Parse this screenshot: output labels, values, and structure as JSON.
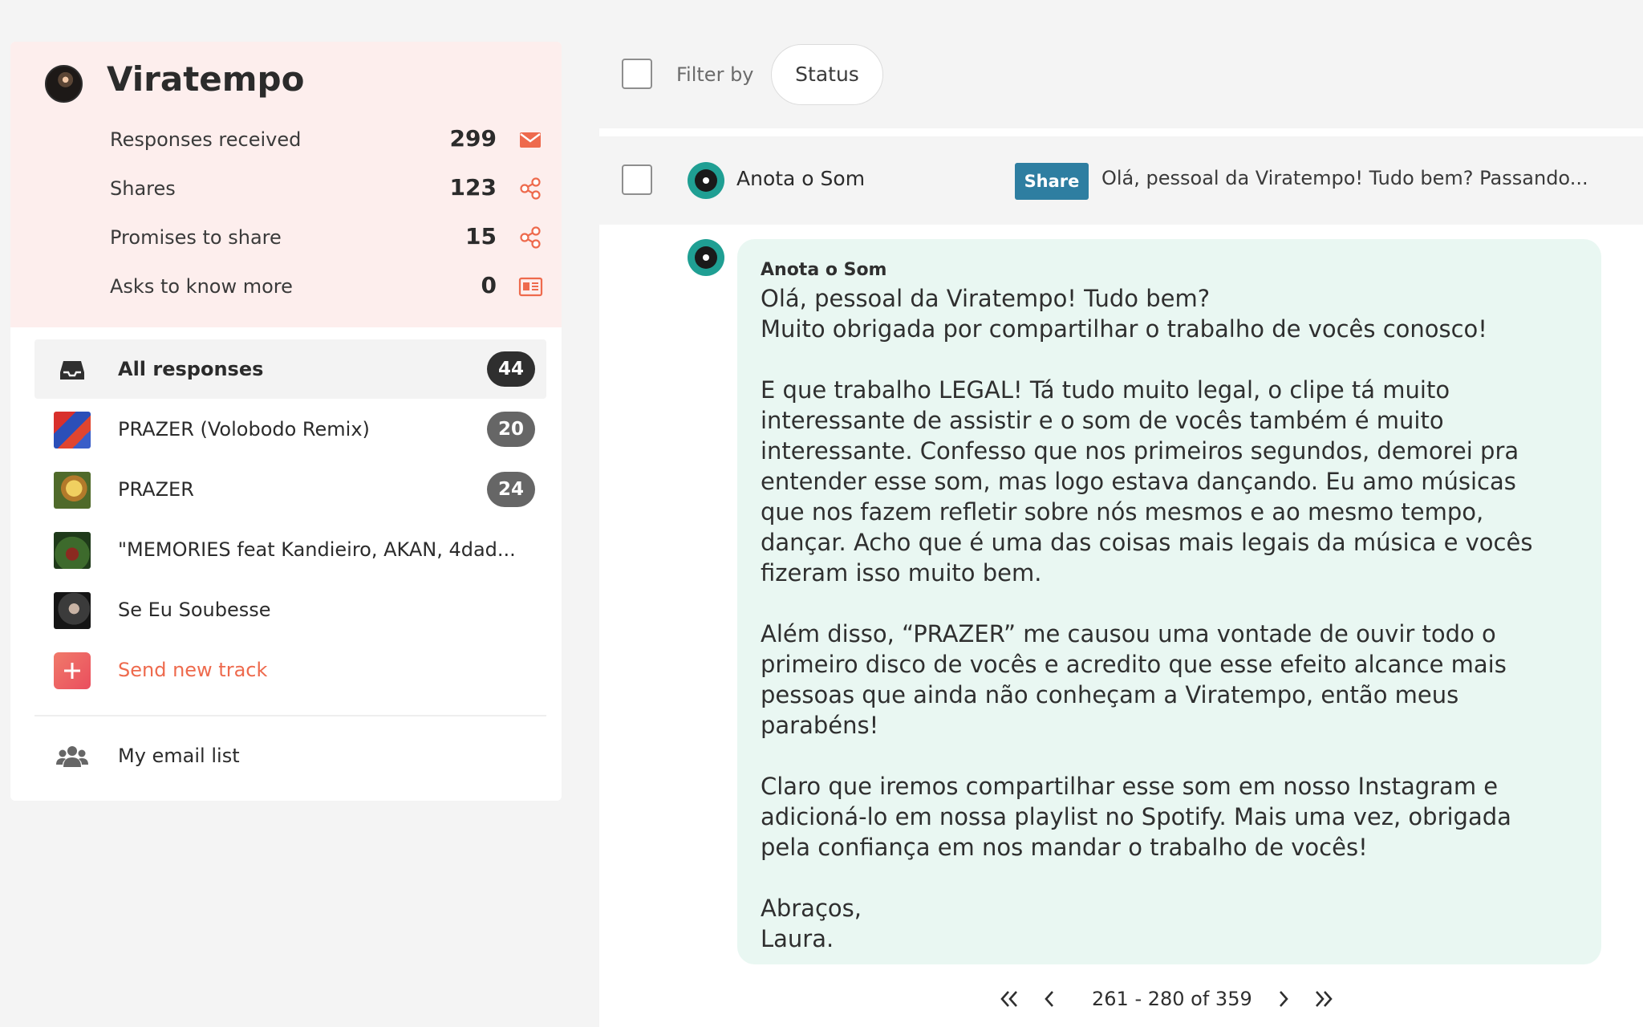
{
  "sidebar": {
    "artist_name": "Viratempo",
    "stats": [
      {
        "label": "Responses received",
        "value": "299",
        "icon": "envelope-icon"
      },
      {
        "label": "Shares",
        "value": "123",
        "icon": "share-icon"
      },
      {
        "label": "Promises to share",
        "value": "15",
        "icon": "share-icon"
      },
      {
        "label": "Asks to know more",
        "value": "0",
        "icon": "contact-card-icon"
      }
    ],
    "nav": [
      {
        "label": "All responses",
        "count": "44",
        "icon": "inbox-icon"
      },
      {
        "label": "PRAZER (Volobodo Remix)",
        "count": "20"
      },
      {
        "label": "PRAZER",
        "count": "24"
      },
      {
        "label": "\"MEMORIES feat Kandieiro, AKAN, 4dad...",
        "count": ""
      },
      {
        "label": "Se Eu Soubesse",
        "count": ""
      }
    ],
    "send_new_track": "Send new track",
    "email_list": "My email list",
    "colors": {
      "accent": "#ee6a4d",
      "header_bg": "#fdeeed"
    }
  },
  "toolbar": {
    "filter_label": "Filter by",
    "status_button": "Status"
  },
  "message": {
    "curator": "Anota o Som",
    "tag": "Share",
    "preview": "Olá, pessoal da Viratempo! Tudo bem? Passando...",
    "bubble_author": "Anota o Som",
    "body": "Olá, pessoal da Viratempo! Tudo bem?\nMuito obrigada por compartilhar o trabalho de vocês conosco!\n\nE que trabalho LEGAL! Tá tudo muito legal, o clipe tá muito\ninteressante de assistir e o som de vocês também é muito\ninteressante. Confesso que nos primeiros segundos, demorei pra\nentender esse som, mas logo estava dançando. Eu amo músicas\nque nos fazem refletir sobre nós mesmos e ao mesmo tempo,\ndançar. Acho que é uma das coisas mais legais da música e vocês\nfizeram isso muito bem.\n\nAlém disso, “PRAZER” me causou uma vontade de ouvir todo o\nprimeiro disco de vocês e acredito que esse efeito alcance mais\npessoas que ainda não conheçam a Viratempo, então meus\nparabéns!\n\nClaro que iremos compartilhar esse som em nosso Instagram e\nadicioná-lo em nossa playlist no Spotify. Mais uma vez, obrigada\npela confiança em nos mandar o trabalho de vocês!\n\nAbraços,\nLaura.",
    "colors": {
      "tag_bg": "#2e7ea1",
      "bubble_bg": "#e9f7f2",
      "avatar": "#1f9f93"
    }
  },
  "pagination": {
    "range": "261 - 280 of 359"
  }
}
